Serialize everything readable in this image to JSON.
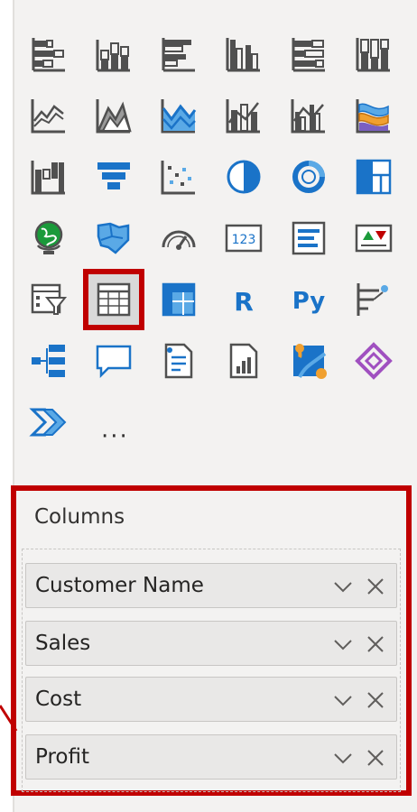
{
  "visualizations": {
    "rows": [
      [
        "stacked-bar-chart-icon",
        "stacked-column-chart-icon",
        "clustered-bar-chart-icon",
        "clustered-column-chart-icon",
        "100-stacked-bar-chart-icon",
        "100-stacked-column-chart-icon"
      ],
      [
        "line-chart-icon",
        "area-chart-icon",
        "stacked-area-chart-icon",
        "line-and-stacked-column-chart-icon",
        "line-and-clustered-column-chart-icon",
        "ribbon-chart-icon"
      ],
      [
        "waterfall-chart-icon",
        "funnel-chart-icon",
        "scatter-chart-icon",
        "pie-chart-icon",
        "donut-chart-icon",
        "treemap-icon"
      ],
      [
        "map-icon",
        "filled-map-icon",
        "gauge-icon",
        "card-icon",
        "multi-row-card-icon",
        "kpi-icon"
      ],
      [
        "slicer-icon",
        "table-icon",
        "matrix-icon",
        "r-script-visual-icon",
        "python-visual-icon",
        "key-influencers-icon"
      ],
      [
        "decomposition-tree-icon",
        "qa-icon",
        "smart-narrative-icon",
        "paginated-report-icon",
        "azure-map-icon",
        "power-apps-icon"
      ],
      [
        "power-automate-icon"
      ]
    ],
    "selected": "table-icon",
    "r_label": "R",
    "py_label": "Py",
    "card_label": "123",
    "more_label": "···"
  },
  "fields": {
    "title": "Columns",
    "items": [
      {
        "label": "Customer Name"
      },
      {
        "label": "Sales"
      },
      {
        "label": "Cost"
      },
      {
        "label": "Profit"
      }
    ]
  },
  "colors": {
    "accent_red": "#c00000",
    "icon_dark": "#505050",
    "icon_blue": "#1a73c8",
    "icon_light_blue": "#5aa9e6",
    "panel_bg": "#f3f2f1"
  }
}
